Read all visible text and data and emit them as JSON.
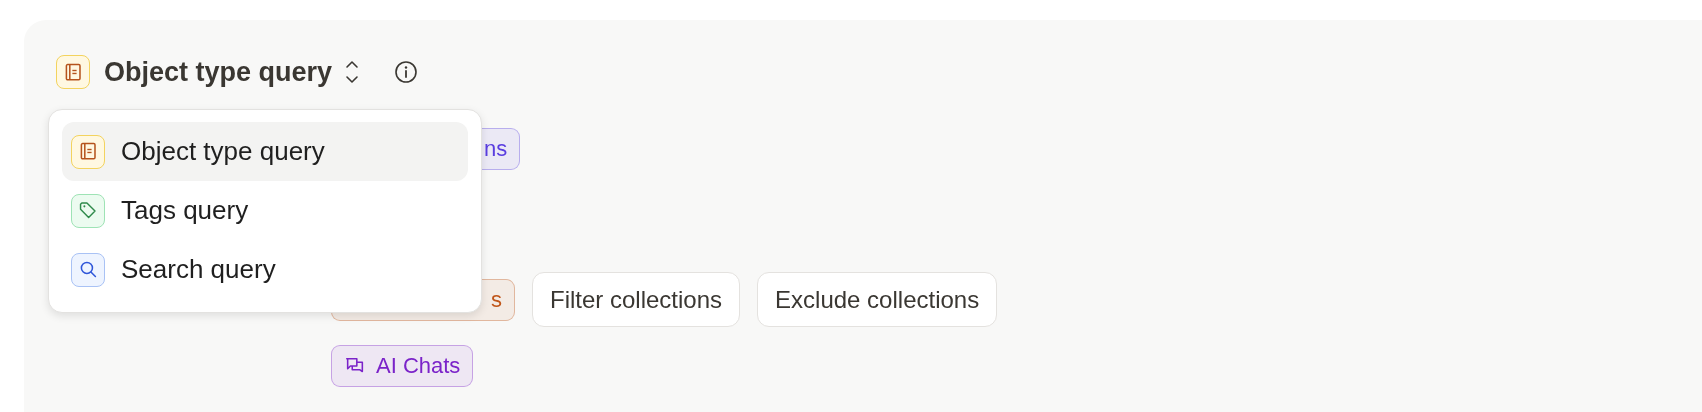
{
  "query_type": {
    "label": "Object type query",
    "kind": "object",
    "expanded": true
  },
  "dropdown": {
    "items": [
      {
        "label": "Object type query",
        "kind": "object",
        "selected": true
      },
      {
        "label": "Tags query",
        "kind": "tag",
        "selected": false
      },
      {
        "label": "Search query",
        "kind": "search",
        "selected": false
      }
    ]
  },
  "rows": [
    [
      {
        "kind": "tag",
        "text": "ns",
        "color": "#5a3ee0"
      }
    ],
    [
      {
        "kind": "tag",
        "text": "s",
        "color": "#c0561a"
      },
      {
        "kind": "button",
        "text": "Filter collections"
      },
      {
        "kind": "button",
        "text": "Exclude collections"
      }
    ],
    [
      {
        "kind": "chat_tag",
        "text": "AI Chats",
        "color": "#7b23c9"
      }
    ]
  ]
}
